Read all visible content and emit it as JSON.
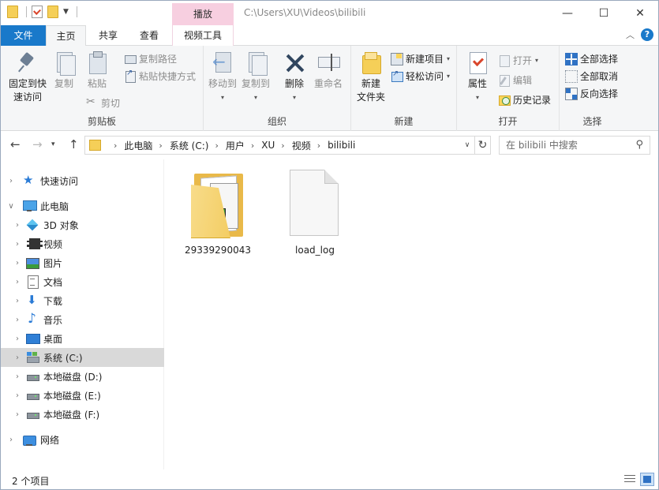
{
  "titlebar": {
    "context_tab": "播放",
    "path": "C:\\Users\\XU\\Videos\\bilibili",
    "minimize": "—",
    "maximize": "☐",
    "close": "✕"
  },
  "tabs": {
    "file": "文件",
    "home": "主页",
    "share": "共享",
    "view": "查看",
    "video_tools": "视频工具",
    "collapse": "︿",
    "help": "?"
  },
  "ribbon": {
    "clipboard": {
      "label": "剪贴板",
      "pin_line1": "固定到快",
      "pin_line2": "速访问",
      "copy": "复制",
      "paste": "粘贴",
      "copy_path": "复制路径",
      "paste_shortcut": "粘贴快捷方式",
      "cut": "剪切"
    },
    "organize": {
      "label": "组织",
      "move_to": "移动到",
      "copy_to": "复制到",
      "delete": "删除",
      "rename": "重命名"
    },
    "new": {
      "label": "新建",
      "new_folder_line1": "新建",
      "new_folder_line2": "文件夹",
      "new_item": "新建项目",
      "easy_access": "轻松访问"
    },
    "open": {
      "label": "打开",
      "properties": "属性",
      "open": "打开",
      "edit": "编辑",
      "history": "历史记录"
    },
    "select": {
      "label": "选择",
      "select_all": "全部选择",
      "select_none": "全部取消",
      "invert": "反向选择"
    }
  },
  "address": {
    "crumbs": [
      "此电脑",
      "系统 (C:)",
      "用户",
      "XU",
      "视频",
      "bilibili"
    ],
    "search_placeholder": "在 bilibili 中搜索"
  },
  "navpane": {
    "quick_access": "快速访问",
    "this_pc": "此电脑",
    "objects3d": "3D 对象",
    "videos": "视频",
    "pictures": "图片",
    "documents": "文档",
    "downloads": "下载",
    "music": "音乐",
    "desktop": "桌面",
    "system_c": "系统 (C:)",
    "disk_d": "本地磁盘 (D:)",
    "disk_e": "本地磁盘 (E:)",
    "disk_f": "本地磁盘 (F:)",
    "network": "网络"
  },
  "files": [
    {
      "name": "29339290043",
      "kind": "folder"
    },
    {
      "name": "load_log",
      "kind": "file"
    }
  ],
  "status": {
    "count": "2 个项目"
  }
}
